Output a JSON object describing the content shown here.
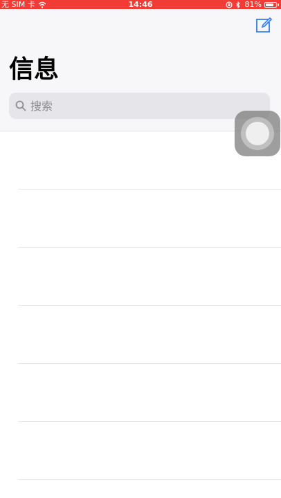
{
  "status_bar": {
    "carrier": "无 SIM 卡",
    "time": "14:46",
    "battery": "81%",
    "battery_level": 0.81,
    "icons": [
      "wifi-icon",
      "lock-rotation-icon",
      "bluetooth-icon",
      "battery-icon"
    ]
  },
  "header": {
    "title": "信息",
    "compose_icon": "compose-icon"
  },
  "search": {
    "placeholder": "搜索",
    "value": ""
  },
  "colors": {
    "status_bar": "#f23b35",
    "accent": "#2f7cf6",
    "header_bg": "#f7f6f8",
    "search_bg": "#e6e6ea"
  },
  "list": {
    "rows": 6
  },
  "assistive_touch": {
    "icon": "assistive-touch-icon"
  }
}
